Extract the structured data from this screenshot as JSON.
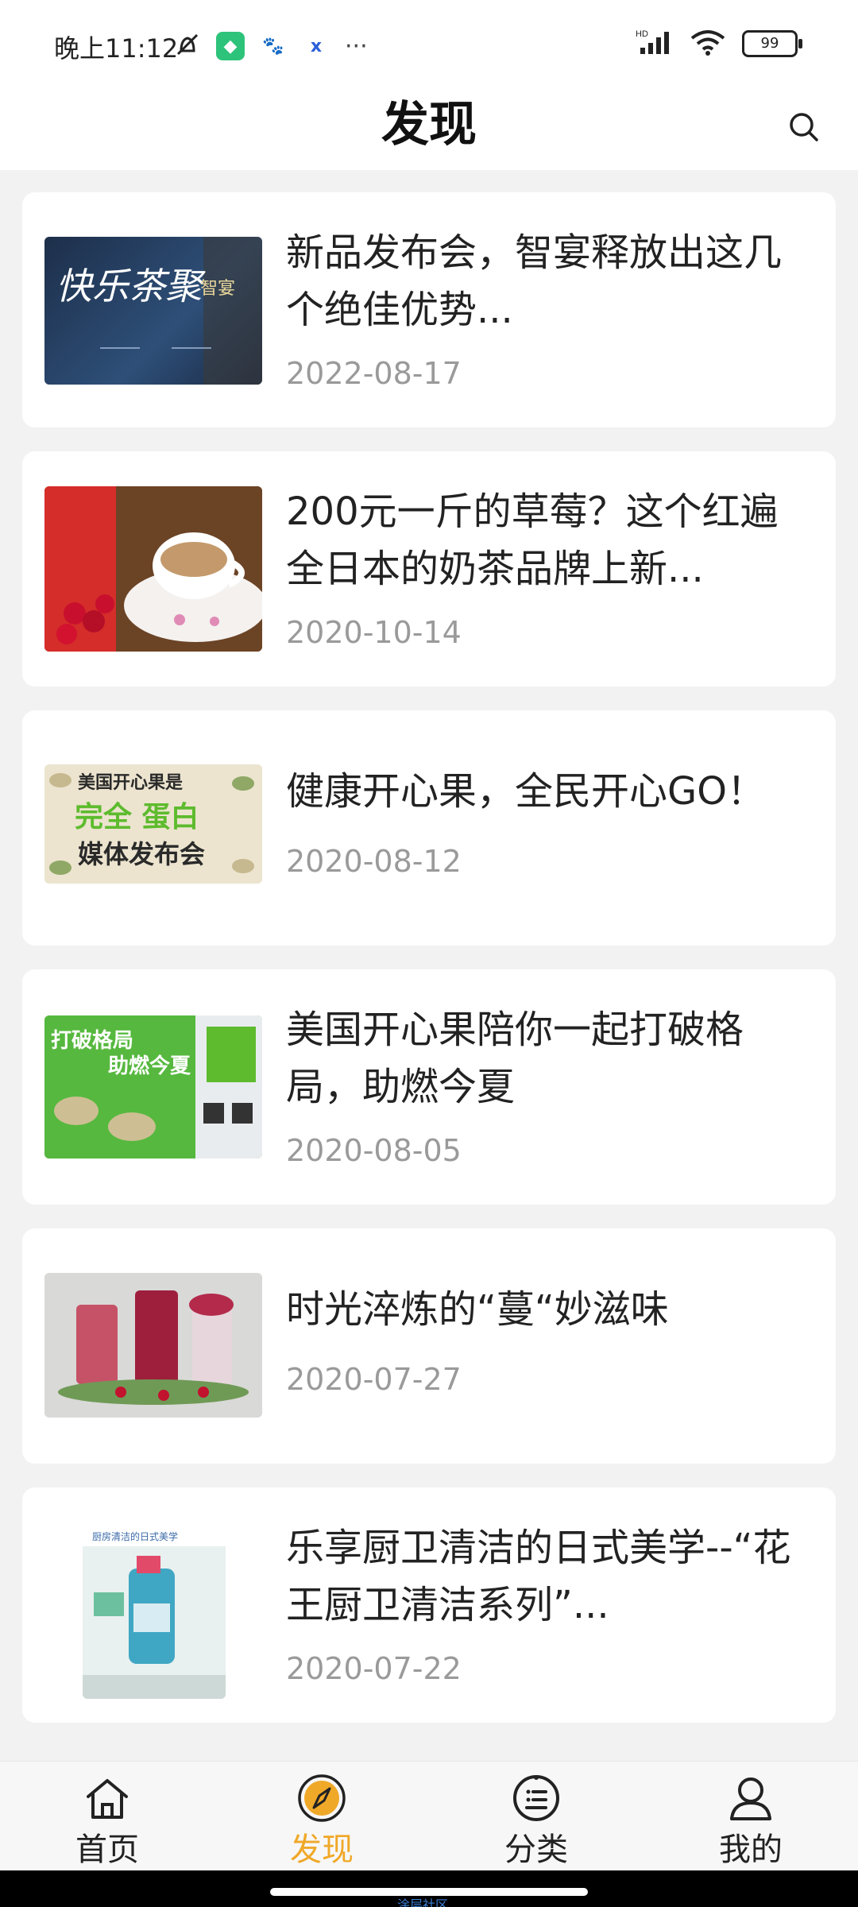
{
  "status_bar": {
    "time": "晚上11:12",
    "battery": "99",
    "network": "HD"
  },
  "header": {
    "title": "发现"
  },
  "articles": [
    {
      "title": "新品发布会，智宴释放出这几个绝佳优势...",
      "date": "2022-08-17"
    },
    {
      "title": "200元一斤的草莓？这个红遍全日本的奶茶品牌上新...",
      "date": "2020-10-14"
    },
    {
      "title": "健康开心果，全民开心GO！",
      "date": "2020-08-12"
    },
    {
      "title": "美国开心果陪你一起打破格局，助燃今夏",
      "date": "2020-08-05"
    },
    {
      "title": "时光淬炼的“蔓“妙滋味",
      "date": "2020-07-27"
    },
    {
      "title": "乐享厨卫清洁的日式美学--“花王厨卫清洁系列”...",
      "date": "2020-07-22"
    }
  ],
  "thumb_text": {
    "t1_main": "快乐茶聚",
    "t1_sub": "智宴",
    "t3_line1": "美国开心果是",
    "t3_line2": "完全 蛋白",
    "t3_line3": "媒体发布会",
    "t4_line1": "打破格局",
    "t4_line2": "助燃今夏",
    "t6_header": "厨房清洁的日式美学"
  },
  "tabs": [
    {
      "label": "首页",
      "icon": "home-icon"
    },
    {
      "label": "发现",
      "icon": "compass-icon"
    },
    {
      "label": "分类",
      "icon": "category-icon"
    },
    {
      "label": "我的",
      "icon": "user-icon"
    }
  ],
  "watermark": "涂层社区",
  "colors": {
    "accent": "#f0a828",
    "background": "#f2f2f2",
    "card": "#ffffff",
    "date": "#9a9a9a"
  }
}
